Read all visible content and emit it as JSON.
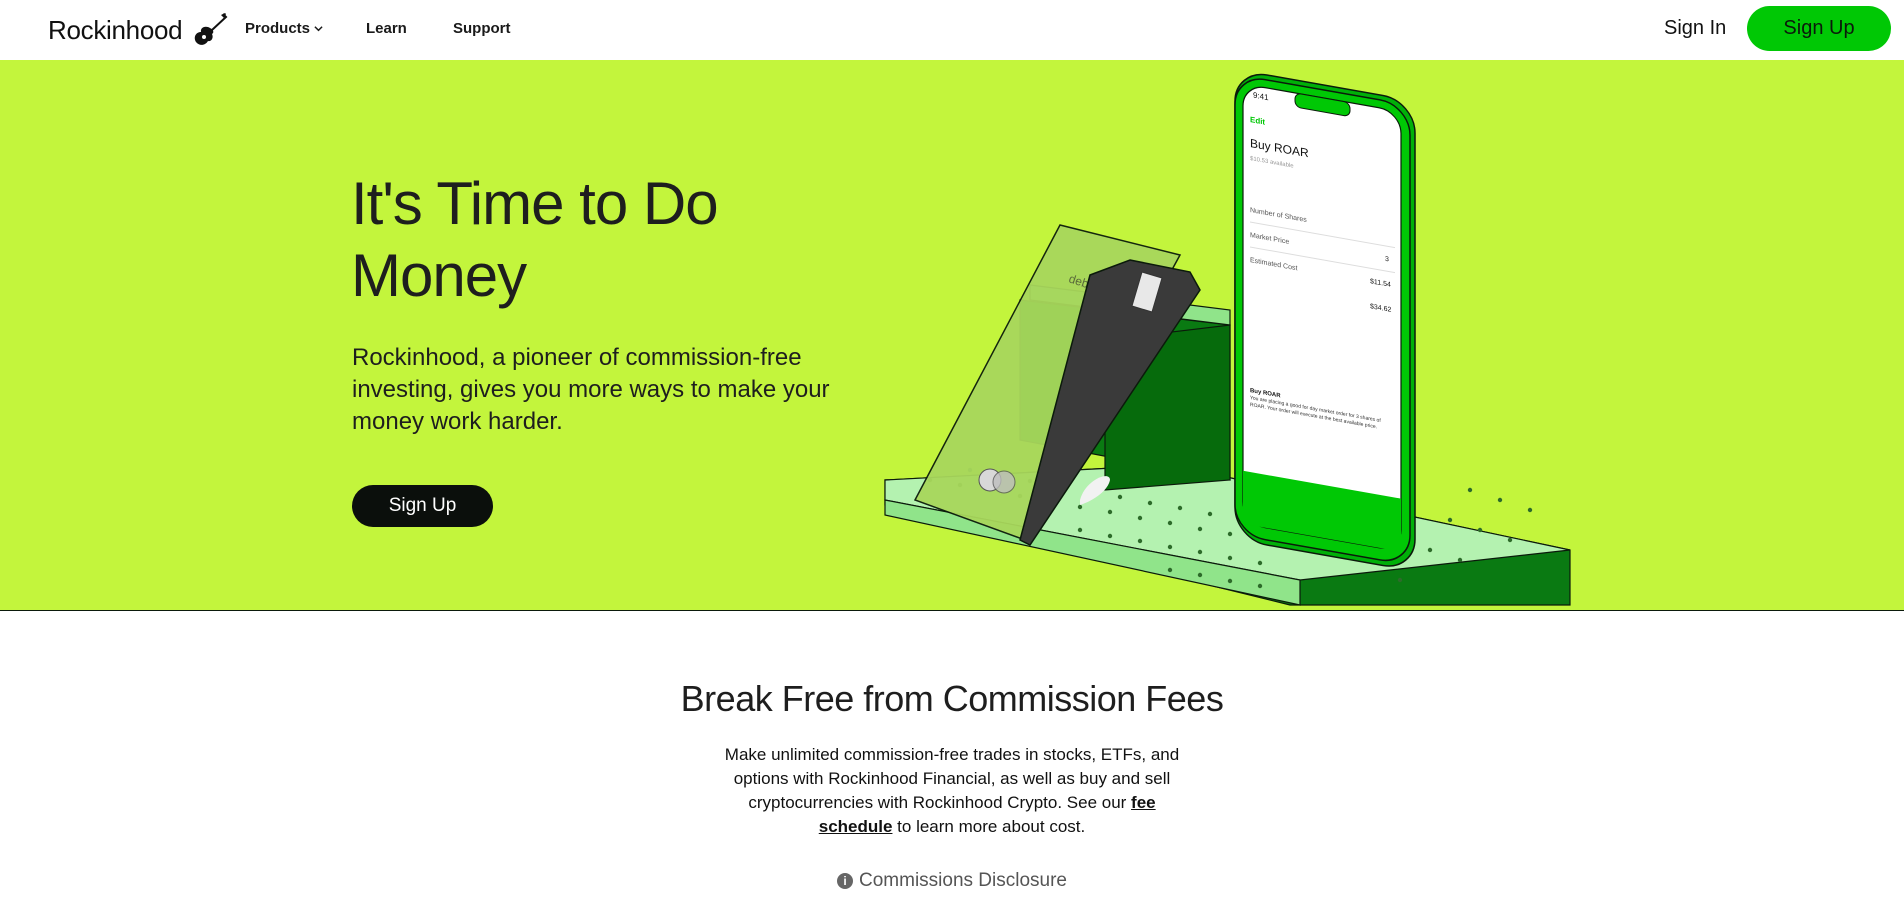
{
  "nav": {
    "brand": "Rockinhood",
    "brand_icon": "guitar-icon",
    "links": [
      {
        "label": "Products",
        "icon": "chevron-down-icon"
      },
      {
        "label": "Learn"
      },
      {
        "label": "Support"
      }
    ],
    "sign_in": "Sign In",
    "sign_up": "Sign Up"
  },
  "hero": {
    "title": "It's Time to Do Money",
    "subtitle": "Rockinhood, a pioneer of commission-free investing, gives you more ways to make your money work harder.",
    "cta": "Sign Up",
    "background": "#c3f53c",
    "phone": {
      "time": "9:41",
      "edit": "Edit",
      "heading": "Buy ROAR",
      "available": "$10.53 available",
      "rows": [
        {
          "label": "Number of Shares",
          "value": ""
        },
        {
          "label": "Market Price",
          "value": "3"
        },
        {
          "label": "Estimated Cost",
          "value": "$11.54"
        },
        {
          "label": "",
          "value": "$34.62"
        }
      ],
      "footer_title": "Buy ROAR",
      "footer_text": "You are placing a good for day market order for 3 shares of ROAR. Your order will execute at the best available price."
    },
    "card": {
      "label": "debit",
      "network": "mastercard"
    }
  },
  "section": {
    "title": "Break Free from Commission Fees",
    "body_before": "Make unlimited commission-free trades in stocks, ETFs, and options with Rockinhood Financial, as well as buy and sell cryptocurrencies with Rockinhood Crypto. See our ",
    "link": "fee schedule",
    "body_after": " to learn more about cost.",
    "disclosure": "Commissions Disclosure",
    "disclosure_icon": "info-icon"
  },
  "colors": {
    "brand_green": "#00c805",
    "hero_lime": "#c3f53c",
    "dark": "#0b0f0c"
  }
}
